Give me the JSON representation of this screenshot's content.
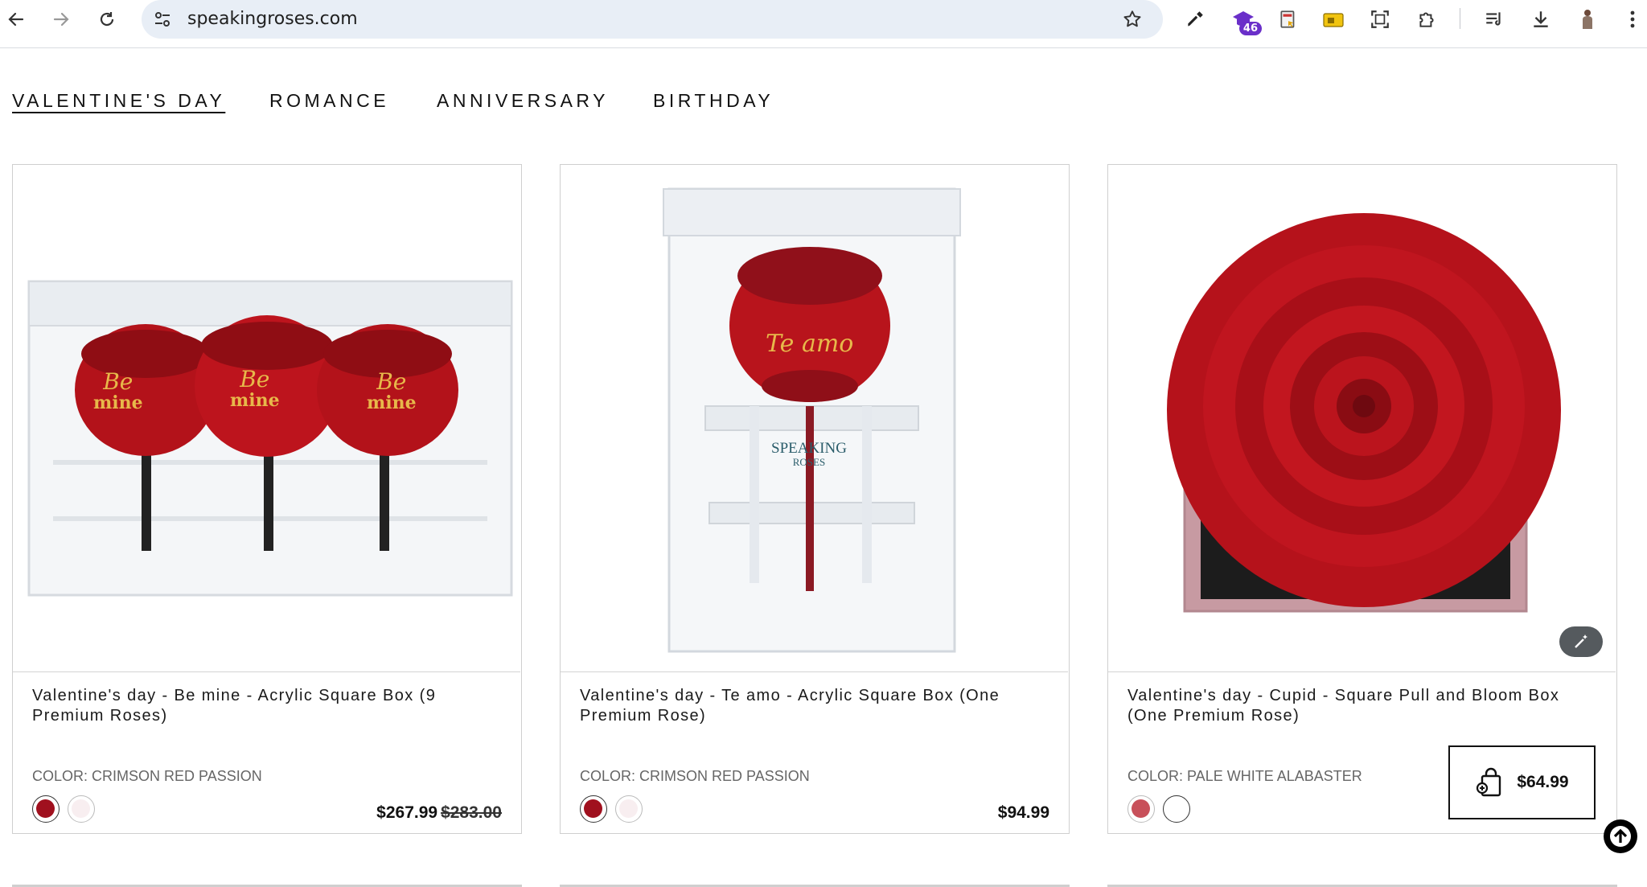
{
  "browser": {
    "url": "speakingroses.com",
    "extension_badge": "46",
    "icons": [
      "back-arrow-icon",
      "forward-arrow-icon",
      "reload-icon",
      "site-info-icon",
      "bookmark-star-icon",
      "eyedropper-icon",
      "extension-graduation-icon",
      "extension-page-icon",
      "extension-folder-icon",
      "screenshot-icon",
      "extensions-puzzle-icon",
      "media-control-icon",
      "download-icon",
      "profile-avatar-icon",
      "menu-kebab-icon"
    ]
  },
  "nav": {
    "categories": [
      {
        "label": "VALENTINE'S DAY",
        "active": true
      },
      {
        "label": "ROMANCE",
        "active": false
      },
      {
        "label": "ANNIVERSARY",
        "active": false
      },
      {
        "label": "BIRTHDAY",
        "active": false
      }
    ]
  },
  "products": [
    {
      "title": "Valentine's day - Be mine - Acrylic Square Box (9 Premium Roses)",
      "color_label": "COLOR: CRIMSON RED PASSION",
      "swatches": [
        "#a0101e",
        "#f8eef0"
      ],
      "price": "$267.99",
      "price_old": "$283.00",
      "engraving": [
        "Be",
        "mine"
      ]
    },
    {
      "title": "Valentine's day - Te amo - Acrylic Square Box (One Premium Rose)",
      "color_label": "COLOR: CRIMSON RED PASSION",
      "swatches": [
        "#a0101e",
        "#f8eef0"
      ],
      "price": "$94.99",
      "engraving": [
        "Te amo"
      ],
      "brand_mark": [
        "SPEAKING",
        "ROSES"
      ]
    },
    {
      "title": "Valentine's day - Cupid - Square Pull and Bloom Box (One Premium Rose)",
      "color_label": "COLOR: PALE WHITE ALABASTER",
      "swatches": [
        "#c8505a",
        "#ffffff"
      ],
      "price": "$64.99"
    }
  ],
  "colors": {
    "accent_rose": "#b8141c",
    "text": "#1a1a1a",
    "muted": "#666666"
  }
}
